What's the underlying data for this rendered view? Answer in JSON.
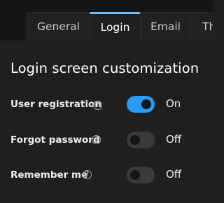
{
  "tabs": [
    {
      "label": "General",
      "active": false
    },
    {
      "label": "Login",
      "active": true
    },
    {
      "label": "Email",
      "active": false
    },
    {
      "label": "Th",
      "active": false
    }
  ],
  "section": {
    "title": "Login screen customization"
  },
  "settings": [
    {
      "label": "User registration",
      "enabled": true,
      "state_label": "On",
      "help_icon": "question-circle-icon"
    },
    {
      "label": "Forgot password",
      "enabled": false,
      "state_label": "Off",
      "help_icon": "question-circle-icon"
    },
    {
      "label": "Remember me",
      "enabled": false,
      "state_label": "Off",
      "help_icon": "question-circle-icon"
    }
  ],
  "colors": {
    "accent": "#2b9af3",
    "active_tab_border": "#73bcf7",
    "background": "#1f1f1f",
    "tabbar_background": "#151515",
    "switch_off": "#3b3b3b"
  }
}
